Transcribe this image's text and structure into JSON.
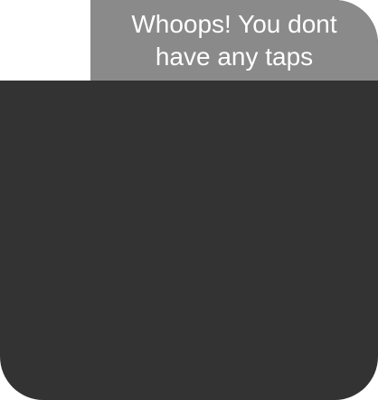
{
  "notice": {
    "message": "Whoops! You dont\nhave any taps"
  },
  "colors": {
    "panel_background": "#333333",
    "tab_background": "#8a8a8a",
    "text": "#ffffff",
    "page_background": "#ffffff"
  }
}
